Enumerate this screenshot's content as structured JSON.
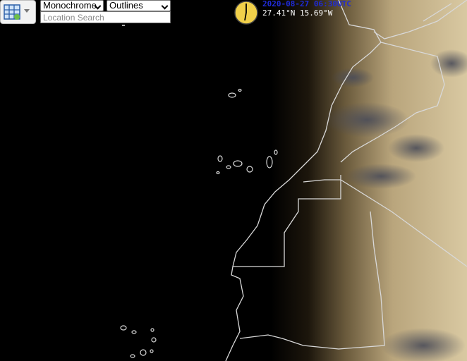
{
  "toolbar": {
    "product_select": {
      "value": "Monochrome"
    },
    "overlay_select": {
      "value": "Outlines"
    },
    "location_search": {
      "placeholder": "Location Search",
      "value": ""
    }
  },
  "status": {
    "timestamp": "2020-08-27 06:30UTC",
    "cursor_coordinates": "27.41°N 15.69°W"
  },
  "map": {
    "region": "Northwest Africa and Canary Islands",
    "colors": {
      "ocean_night": "#000000",
      "desert": "#c8b48a",
      "outline": "#d8d8d8",
      "timestamp_text": "#1f2bd6"
    }
  }
}
